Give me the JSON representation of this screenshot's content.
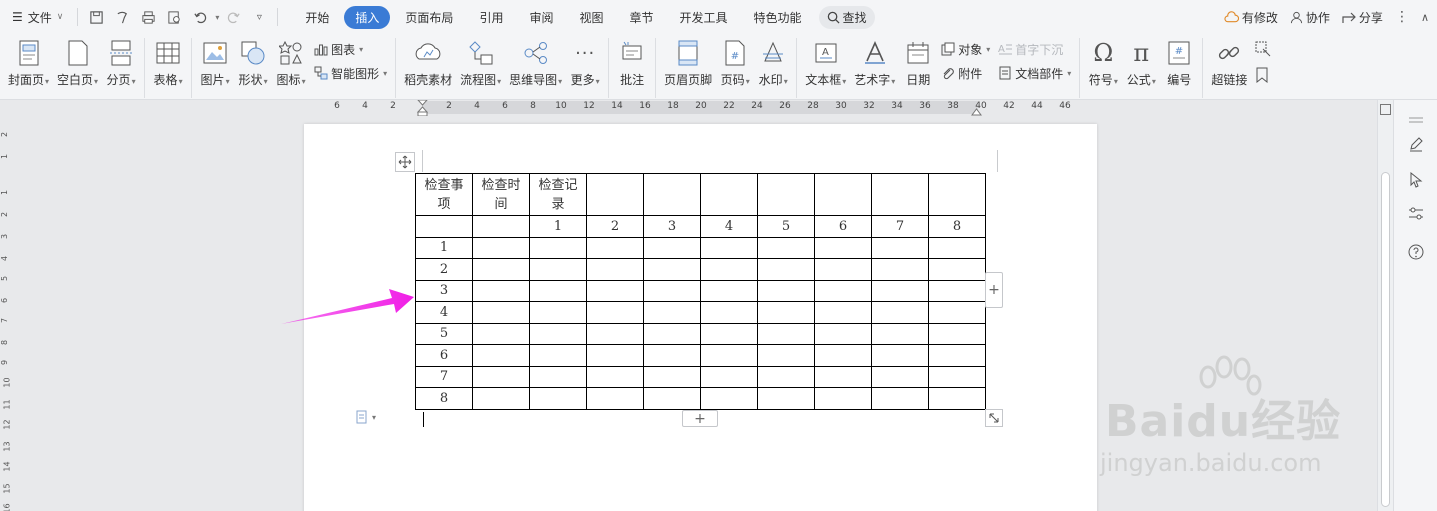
{
  "menubar": {
    "file_label": "文件",
    "tabs": [
      {
        "label": "开始",
        "active": false
      },
      {
        "label": "插入",
        "active": true
      },
      {
        "label": "页面布局",
        "active": false
      },
      {
        "label": "引用",
        "active": false
      },
      {
        "label": "审阅",
        "active": false
      },
      {
        "label": "视图",
        "active": false
      },
      {
        "label": "章节",
        "active": false
      },
      {
        "label": "开发工具",
        "active": false
      },
      {
        "label": "特色功能",
        "active": false
      }
    ],
    "search_label": "查找",
    "right": {
      "modified": "有修改",
      "collab": "协作",
      "share": "分享"
    }
  },
  "ribbon": {
    "cover": "封面页",
    "blank": "空白页",
    "pagebreak": "分页",
    "table": "表格",
    "picture": "图片",
    "shape": "形状",
    "icon": "图标",
    "chart": "图表",
    "smartart": "智能图形",
    "daoke": "稻壳素材",
    "flow": "流程图",
    "mindmap": "思维导图",
    "more": "更多",
    "comment": "批注",
    "headerfooter": "页眉页脚",
    "pagenum": "页码",
    "watermark": "水印",
    "textbox": "文本框",
    "wordart": "艺术字",
    "date": "日期",
    "object": "对象",
    "attachment": "附件",
    "dropcap": "首字下沉",
    "docpart": "文档部件",
    "symbol": "符号",
    "formula": "公式",
    "numbering": "编号",
    "hyperlink": "超链接"
  },
  "ruler": {
    "h": [
      "6",
      "4",
      "2",
      "2",
      "4",
      "6",
      "8",
      "10",
      "12",
      "14",
      "16",
      "18",
      "20",
      "22",
      "24",
      "26",
      "28",
      "30",
      "32",
      "34",
      "36",
      "38",
      "40",
      "42",
      "44",
      "46"
    ],
    "v": [
      "2",
      "1",
      "1",
      "2",
      "3",
      "4",
      "5",
      "6",
      "7",
      "8",
      "9",
      "10",
      "11",
      "12",
      "13",
      "14",
      "15",
      "16"
    ]
  },
  "table": {
    "header": [
      "检查事项",
      "检查时间",
      "检查记录",
      "",
      "",
      "",
      "",
      "",
      "",
      ""
    ],
    "subheader": [
      "",
      "",
      "1",
      "2",
      "3",
      "4",
      "5",
      "6",
      "7",
      "8"
    ],
    "row_labels": [
      "1",
      "2",
      "3",
      "4",
      "5",
      "6",
      "7",
      "8"
    ]
  },
  "watermark": {
    "brand": "Baidu经验",
    "url": "jingyan.baidu.com"
  },
  "colors": {
    "accent": "#3a7bd5",
    "arrow": "#f01ee6"
  }
}
